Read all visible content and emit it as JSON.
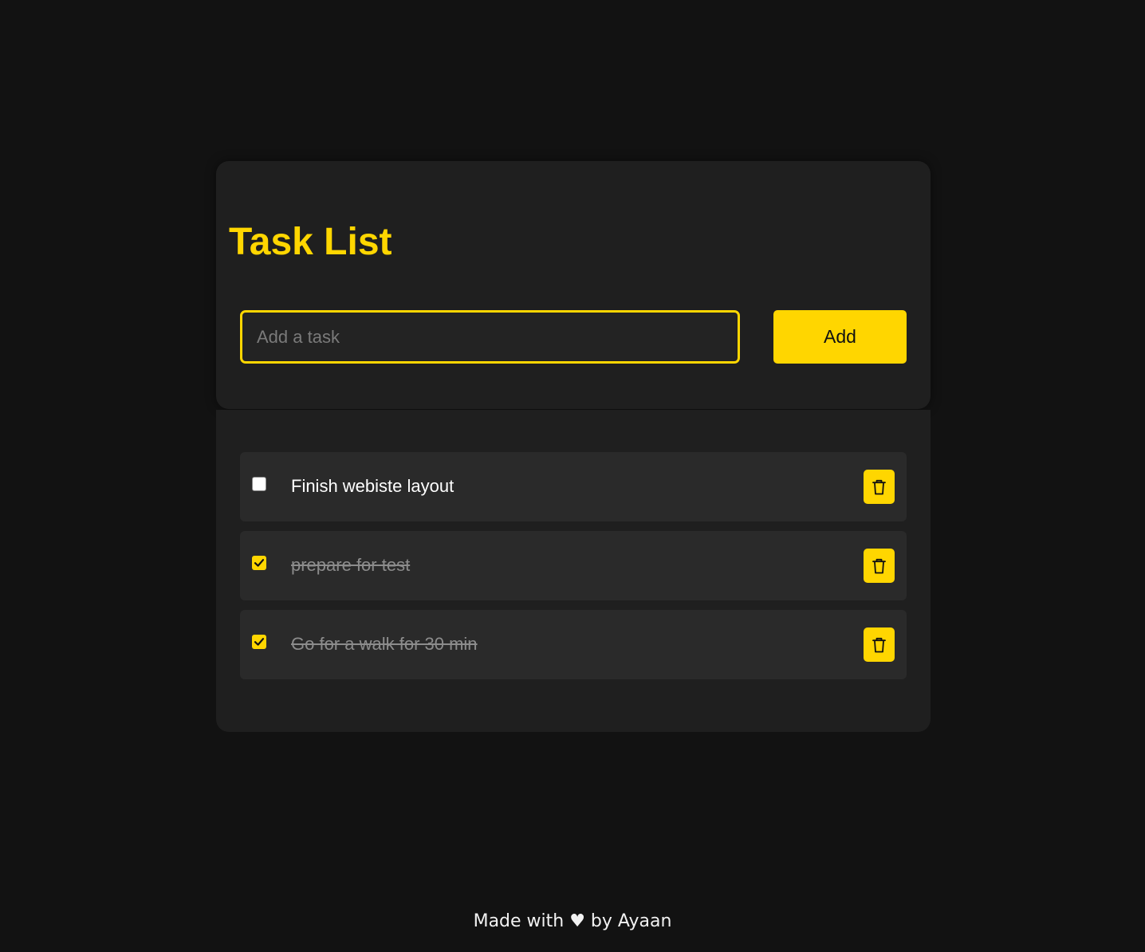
{
  "header": {
    "title": "Task List"
  },
  "task_input": {
    "placeholder": "Add a task",
    "value": ""
  },
  "add_button": {
    "label": "Add"
  },
  "tasks": [
    {
      "text": "Finish webiste layout",
      "completed": false,
      "delete_icon": "trash-icon"
    },
    {
      "text": "prepare for test",
      "completed": true,
      "delete_icon": "trash-icon"
    },
    {
      "text": "Go for a walk for 30 min",
      "completed": true,
      "delete_icon": "trash-icon"
    }
  ],
  "footer": {
    "text": "Made with ♥ by Ayaan"
  },
  "colors": {
    "background": "#121212",
    "card": "#1f1f1f",
    "item": "#2a2a2a",
    "accent": "#ffd600",
    "text": "#ffffff",
    "done_text": "#8c8c8c"
  }
}
